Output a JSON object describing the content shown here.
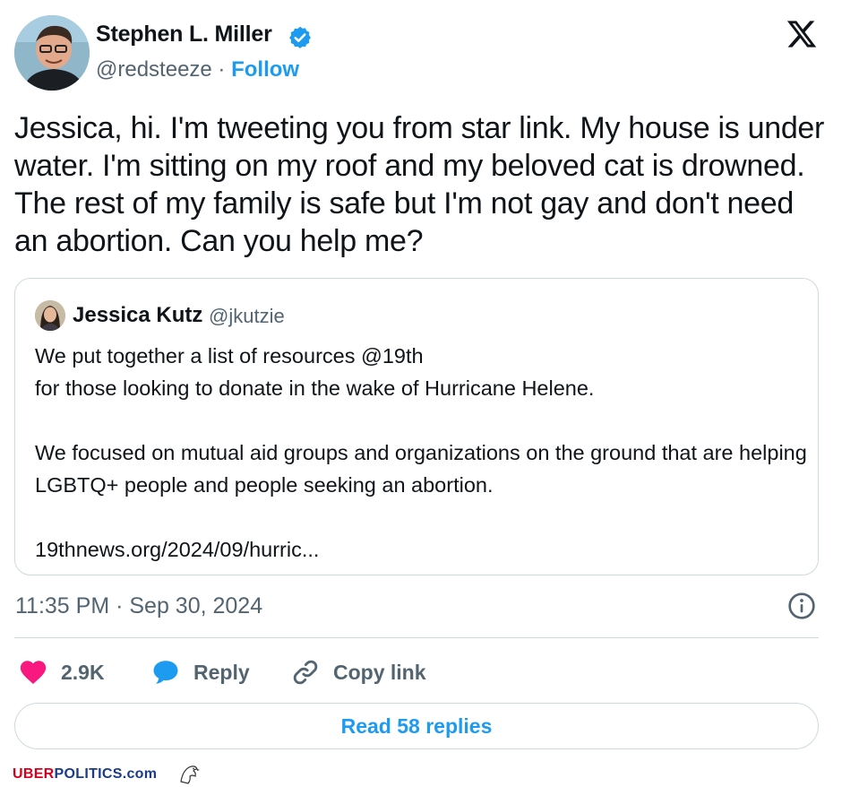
{
  "author": {
    "name": "Stephen L. Miller",
    "handle": "@redsteeze",
    "separator": " · ",
    "follow_label": "Follow"
  },
  "tweet": {
    "text": "Jessica, hi. I'm tweeting you from star link. My house is under water. I'm sitting on my roof and my beloved cat is drowned. The rest of my family is safe but I'm not gay and don't need an abortion. Can you help me?"
  },
  "quoted": {
    "name": "Jessica Kutz",
    "handle": "@jkutzie",
    "body": "We put together a list of resources @19th\nfor those looking to donate in the wake of Hurricane Helene.\n\nWe focused on mutual aid groups and  organizations on the ground that are helping LGBTQ+ people and people seeking an abortion.\n\n19thnews.org/2024/09/hurric..."
  },
  "meta": {
    "timestamp": "11:35 PM · Sep 30, 2024"
  },
  "actions": {
    "likes": "2.9K",
    "reply_label": "Reply",
    "copy_link_label": "Copy link",
    "read_replies_label": "Read 58 replies"
  },
  "watermark": {
    "part1": "UBER",
    "part2": "POLITICS",
    "part3": ".com"
  },
  "icons": {
    "verified": "verified-badge-icon",
    "platform": "x-logo-icon",
    "info": "info-icon",
    "like": "heart-icon",
    "reply": "speech-bubble-icon",
    "copy": "link-icon"
  },
  "colors": {
    "accent": "#1d9bf0",
    "secondary_text": "#536471",
    "like": "#f91880",
    "border": "#cfd9de"
  }
}
